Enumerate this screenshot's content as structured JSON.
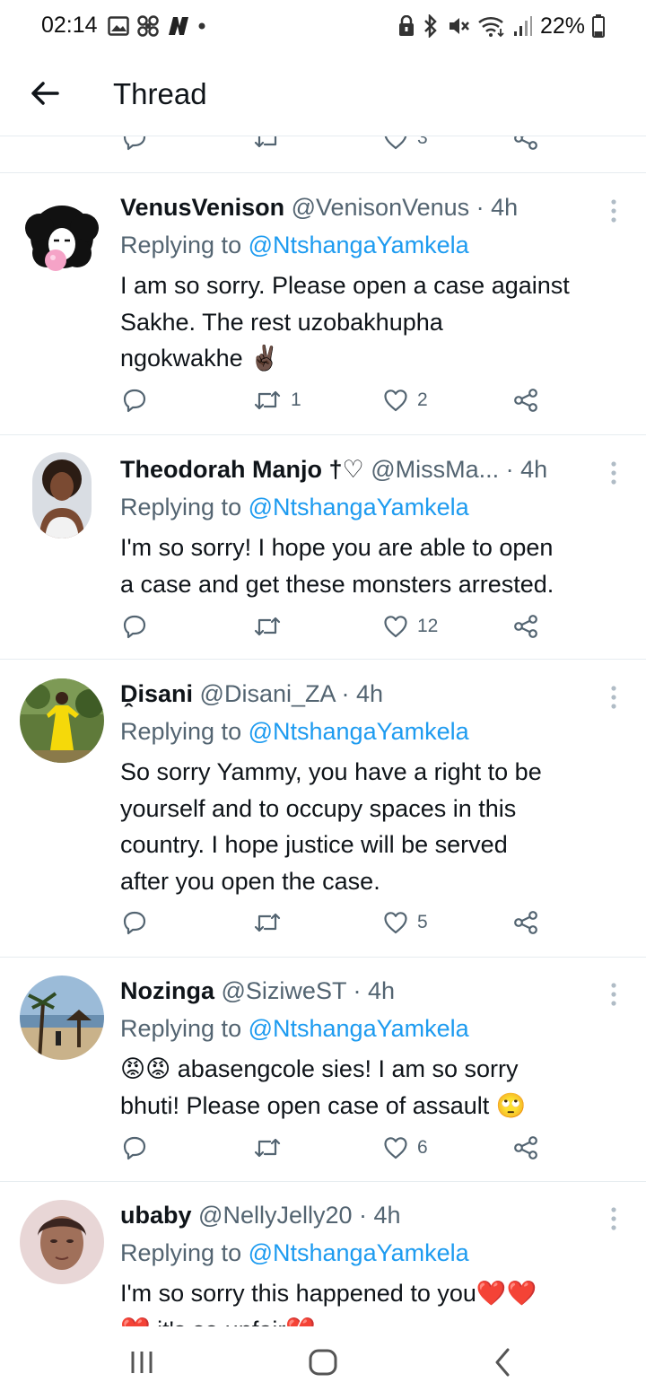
{
  "status": {
    "time": "02:14",
    "battery": "22%"
  },
  "header": {
    "title": "Thread"
  },
  "prev_tweet_actions": {
    "likes": "3"
  },
  "tweets": [
    {
      "name": "VenusVenison",
      "handle": "@VenisonVenus",
      "time": "· 4h",
      "replying_prefix": "Replying to ",
      "replying_to": "@NtshangaYamkela",
      "lines": [
        "I am so sorry. Please open a case against",
        "Sakhe. The rest uzobakhupha",
        "ngokwakhe ✌🏿"
      ],
      "retweets": "1",
      "likes": "2"
    },
    {
      "name": "Theodorah Manjo †♡",
      "handle": "@MissMa...",
      "time": "· 4h",
      "replying_prefix": "Replying to ",
      "replying_to": "@NtshangaYamkela",
      "lines": [
        "I'm so sorry! I hope you are able to open",
        "a case and get these monsters arrested."
      ],
      "retweets": "",
      "likes": "12"
    },
    {
      "name": "Ḓisani",
      "handle": "@Disani_ZA",
      "time": "· 4h",
      "replying_prefix": "Replying to ",
      "replying_to": "@NtshangaYamkela",
      "lines": [
        "So sorry Yammy, you have a right to be",
        "yourself and to occupy spaces in this",
        "country. I hope justice will be served",
        "after you open the case."
      ],
      "retweets": "",
      "likes": "5"
    },
    {
      "name": "Nozinga",
      "handle": "@SiziweST",
      "time": "· 4h",
      "replying_prefix": "Replying to ",
      "replying_to": "@NtshangaYamkela",
      "lines": [
        "😡😡 abasengcole sies! I am so sorry",
        "bhuti! Please open case of assault 🙄"
      ],
      "retweets": "",
      "likes": "6"
    },
    {
      "name": "ubaby",
      "handle": "@NellyJelly20",
      "time": "· 4h",
      "replying_prefix": "Replying to ",
      "replying_to": "@NtshangaYamkela",
      "lines": [
        "I'm so sorry this happened to you❤️❤️",
        "❤️ it's so unfair💔"
      ],
      "retweets": "",
      "likes": ""
    }
  ],
  "icons": {
    "reply": "reply-icon",
    "retweet": "retweet-icon",
    "like": "heart-icon",
    "share": "share-icon",
    "more": "more-vertical-icon"
  },
  "colors": {
    "mention": "#1d9bf0",
    "secondary_text": "#536471",
    "divider": "#e6ecf0"
  }
}
